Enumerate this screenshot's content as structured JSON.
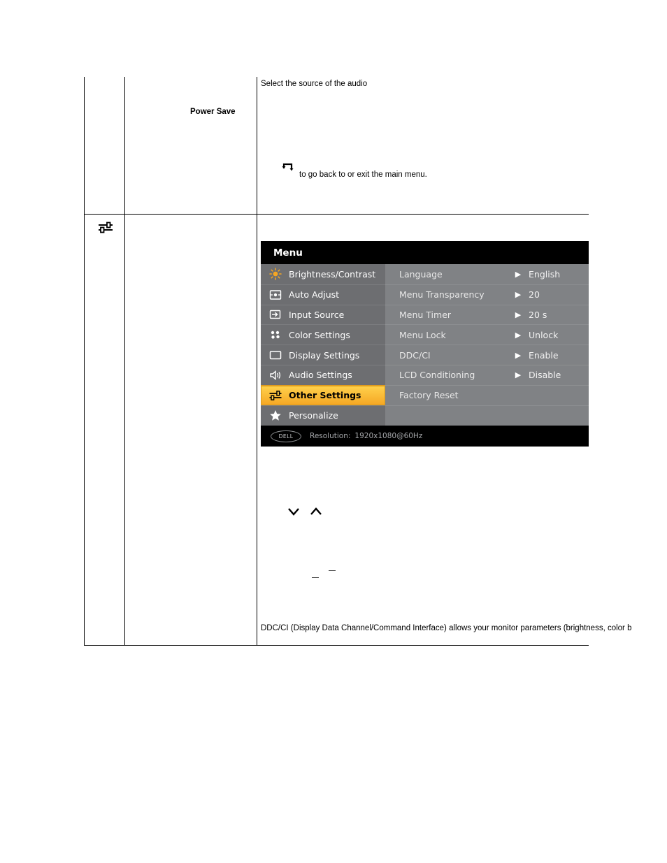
{
  "table": {
    "row1": {
      "label": "Power Save",
      "desc_top": "Select the source of the audio",
      "back_note": "to go back to or exit the main menu."
    },
    "row2": {
      "icon_name": "other-settings-icon",
      "footer_text": "DDC/CI (Display Data Channel/Command Interface) allows your monitor parameters (brightness, color b"
    }
  },
  "osd": {
    "title": "Menu",
    "menu_items": [
      {
        "label": "Brightness/Contrast",
        "icon": "brightness-icon",
        "selected": false
      },
      {
        "label": "Auto Adjust",
        "icon": "auto-adjust-icon",
        "selected": false
      },
      {
        "label": "Input Source",
        "icon": "input-source-icon",
        "selected": false
      },
      {
        "label": "Color Settings",
        "icon": "color-settings-icon",
        "selected": false
      },
      {
        "label": "Display Settings",
        "icon": "display-settings-icon",
        "selected": false
      },
      {
        "label": "Audio Settings",
        "icon": "audio-settings-icon",
        "selected": false
      },
      {
        "label": "Other Settings",
        "icon": "other-settings-icon",
        "selected": true
      },
      {
        "label": "Personalize",
        "icon": "personalize-star-icon",
        "selected": false
      }
    ],
    "options": [
      {
        "label": "Language",
        "value": "English",
        "arrow": "▶"
      },
      {
        "label": "Menu Transparency",
        "value": "20",
        "arrow": "▶"
      },
      {
        "label": "Menu Timer",
        "value": "20 s",
        "arrow": "▶"
      },
      {
        "label": "Menu Lock",
        "value": "Unlock",
        "arrow": "▶"
      },
      {
        "label": "DDC/CI",
        "value": "Enable",
        "arrow": "▶"
      },
      {
        "label": "LCD Conditioning",
        "value": "Disable",
        "arrow": "▶"
      },
      {
        "label": "Factory Reset",
        "value": "",
        "arrow": ""
      },
      {
        "label": "",
        "value": "",
        "arrow": ""
      }
    ],
    "footer": {
      "brand": "DELL",
      "resolution_label": "Resolution:",
      "resolution_value": "1920x1080@60Hz"
    }
  }
}
